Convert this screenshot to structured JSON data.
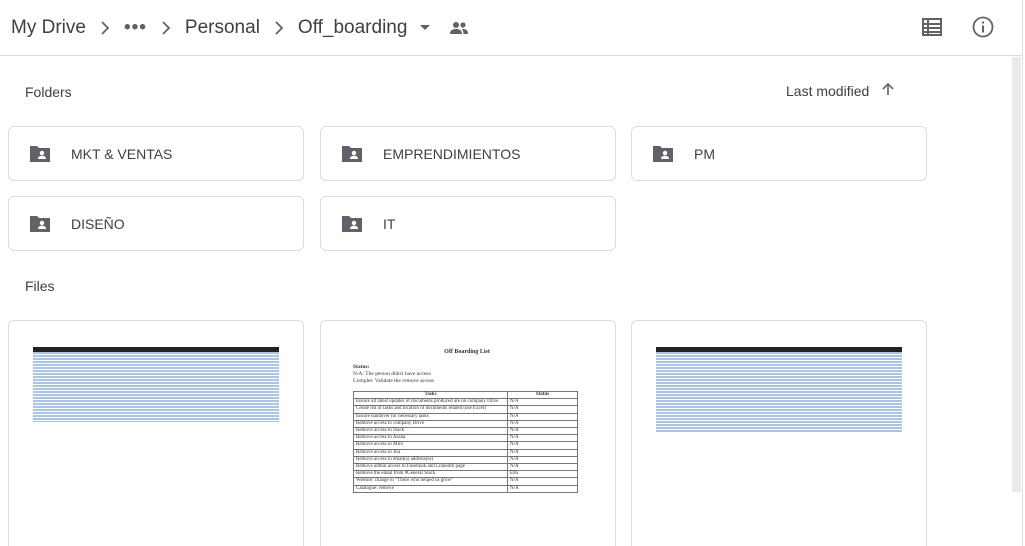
{
  "breadcrumb": {
    "root": "My Drive",
    "more": "•••",
    "parent": "Personal",
    "current": "Off_boarding"
  },
  "icons": {
    "separator": "chevron-right-icon",
    "dropdown": "caret-down-icon",
    "shared": "people-icon",
    "list_view": "list-view-icon",
    "info": "info-icon",
    "folder": "shared-folder-icon",
    "sort": "arrow-up-icon"
  },
  "sections": {
    "folders_label": "Folders",
    "files_label": "Files",
    "sort_label": "Last modified"
  },
  "folders": [
    {
      "name": "MKT & VENTAS"
    },
    {
      "name": "EMPRENDIMIENTOS"
    },
    {
      "name": "PM"
    },
    {
      "name": "DISEÑO"
    },
    {
      "name": "IT"
    }
  ],
  "document": {
    "title": "Off Boarding List",
    "status_heading": "Status:",
    "status_lines": [
      "N/A: The person didn't have access",
      "Complet: Validate the remove access"
    ],
    "columns": [
      "Tasks",
      "Status"
    ],
    "rows": [
      [
        "Ensure all latest updates of documents produced are on company Drive",
        "N/A"
      ],
      [
        "Create list of tasks and location of documents related (use Excel)",
        "N/A"
      ],
      [
        "Ensure handover for necessary tasks",
        "N/A"
      ],
      [
        "Remove access to company Drive",
        "N/A"
      ],
      [
        "Remove access to Slack",
        "N/A"
      ],
      [
        "Remove access to Asana",
        "N/A"
      ],
      [
        "Remove access to Miro",
        "N/A"
      ],
      [
        "Remove access to Jira",
        "N/A"
      ],
      [
        "Remove access to email(s) address(es)",
        "N/A"
      ],
      [
        "Remove admin access to Facebook and LinkedIn page",
        "N/A"
      ],
      [
        "Remove the email from #General Slack",
        "Edu"
      ],
      [
        "Website: change to \"Those who helped us grow\"",
        "N/A"
      ],
      [
        "Catalogue: remove",
        "N/A"
      ]
    ]
  },
  "colors": {
    "border": "#dadce0",
    "text": "#3c4043",
    "icon": "#5f6368",
    "sheet_row": "#a9c3ea"
  }
}
